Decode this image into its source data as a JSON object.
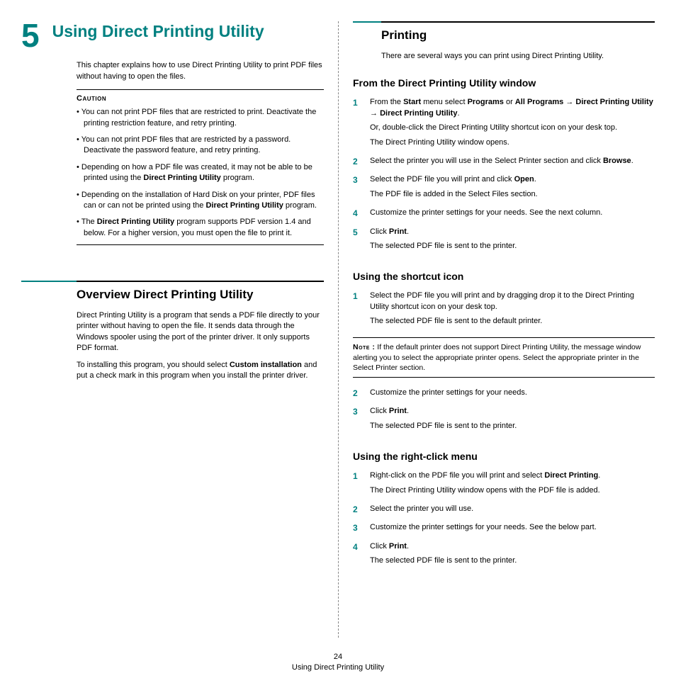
{
  "chapter": {
    "number": "5",
    "title": "Using Direct Printing Utility",
    "intro": "This chapter explains how to use Direct Printing Utility to print PDF files without having to open the files."
  },
  "caution": {
    "label": "Caution",
    "items": [
      "You can not print PDF files that are restricted to print. Deactivate the printing restriction feature, and retry printing.",
      "You can not print PDF files that are restricted by a password. Deactivate the password feature, and retry printing.",
      "Depending on how a PDF file was created, it may not be able to be printed using the <b>Direct Printing Utility</b> program.",
      "Depending on the installation of Hard Disk on your printer, PDF files can or can not be printed using the <b>Direct Printing Utility</b> program.",
      "The <b>Direct Printing Utility</b> program supports PDF version 1.4 and below. For a higher version, you must open the file to print it."
    ]
  },
  "overview": {
    "title": "Overview Direct Printing Utility",
    "p1": "Direct Printing Utility is a program that sends a PDF file directly to your printer without having to open the file. It sends data through the Windows spooler using the port of the printer driver. It only supports PDF format.",
    "p2": "To installing this program, you should select <b>Custom installation</b> and put a check mark in this program when you install the printer driver."
  },
  "printing": {
    "title": "Printing",
    "intro": "There are several ways you can print using Direct Printing Utility.",
    "fromWindow": {
      "title": "From the Direct Printing Utility window",
      "steps": [
        "From the <b>Start</b> menu select <b>Programs</b> or <b>All Programs</b> <span class='arrow'>→</span> <b>Direct Printing Utility</b> <span class='arrow'>→</span> <b>Direct Printing Utility</b>.|Or, double-click the Direct Printing Utility shortcut icon on your desk top.|The Direct Printing Utility window opens.",
        "Select the printer you will use in the Select Printer section and click <b>Browse</b>.",
        "Select the PDF file you will print and click <b>Open</b>.|The PDF file is added in the Select Files section.",
        "Customize the printer settings for your needs. See the next column.",
        "Click <b>Print</b>.|The selected PDF file is sent to the printer."
      ]
    },
    "shortcut": {
      "title": "Using the shortcut icon",
      "steps1": [
        "Select the PDF file you will print and by dragging drop it to the Direct Printing Utility shortcut icon on your desk top.|The selected PDF file is sent to the default printer."
      ],
      "note": "<b>Note :</b> If the default printer does not support Direct Printing Utility, the message window alerting you to select the appropriate printer opens. Select the appropriate printer in the Select Printer section.",
      "steps2start": 2,
      "steps2": [
        "Customize the printer settings for your needs.",
        "Click <b>Print</b>.|The selected PDF file is sent to the printer."
      ]
    },
    "rightClick": {
      "title": "Using the right-click menu",
      "steps": [
        "Right-click on the PDF file you will print and select <b>Direct Printing</b>.|The Direct Printing Utility window opens with the PDF file is added.",
        "Select the printer you will use.",
        "Customize the printer settings for your needs. See the below part.",
        "Click <b>Print</b>.|The selected PDF file is sent to the printer."
      ]
    }
  },
  "footer": {
    "pageNum": "24",
    "pageTitle": "Using Direct Printing Utility"
  }
}
